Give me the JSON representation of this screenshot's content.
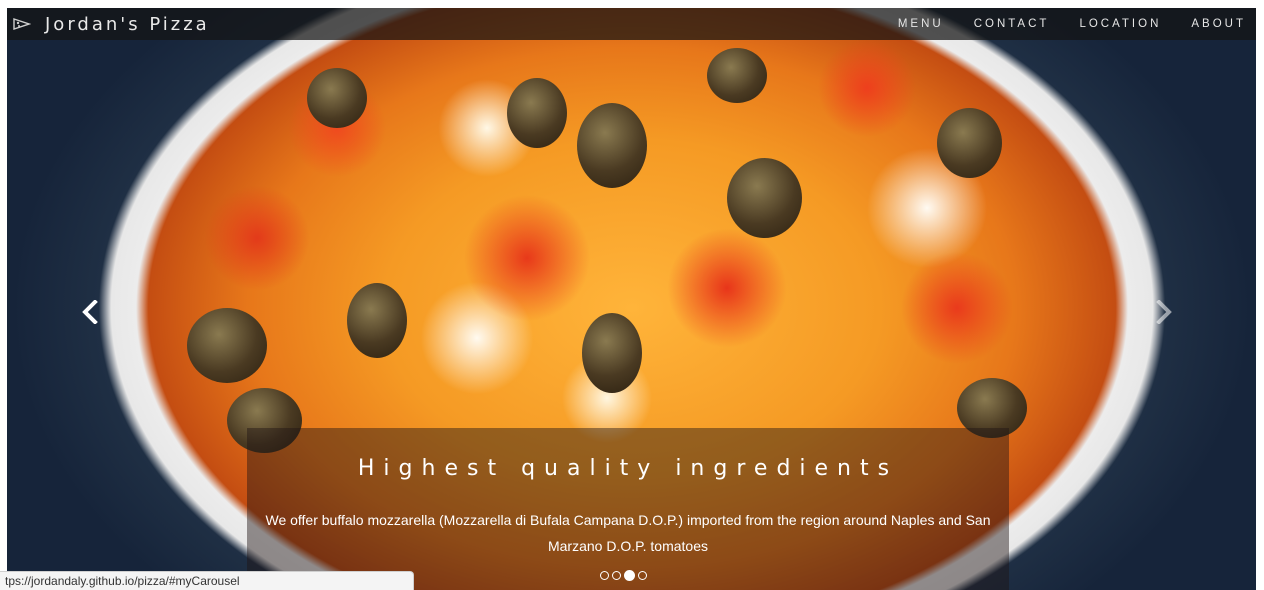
{
  "navbar": {
    "brand": "Jordan's Pizza",
    "links": [
      "MENU",
      "CONTACT",
      "LOCATION",
      "ABOUT"
    ]
  },
  "carousel": {
    "caption_title": "Highest quality ingredients",
    "caption_text": "We offer buffalo mozzarella (Mozzarella di Bufala Campana D.O.P.) imported from the region around Naples and San Marzano D.O.P. tomatoes",
    "indicators_count": 4,
    "active_index": 2
  },
  "statusbar": {
    "url": "tps://jordandaly.github.io/pizza/#myCarousel"
  },
  "icons": {
    "brand": "pizza-slice-icon",
    "prev": "chevron-left-icon",
    "next": "chevron-right-icon"
  },
  "colors": {
    "navbar_bg": "#141414",
    "caption_text": "#ffffff"
  }
}
